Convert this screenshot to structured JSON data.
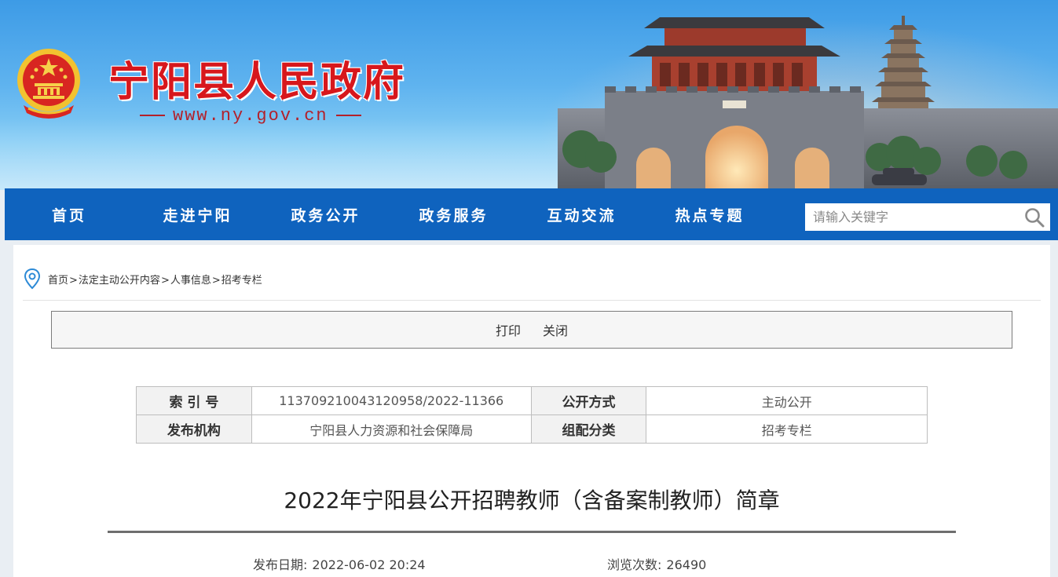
{
  "header": {
    "site_title": "宁阳县人民政府",
    "site_url": "www.ny.gov.cn"
  },
  "nav": {
    "items": [
      "首页",
      "走进宁阳",
      "政务公开",
      "政务服务",
      "互动交流",
      "热点专题"
    ],
    "search_placeholder": "请输入关键字"
  },
  "breadcrumb": {
    "items": [
      "首页",
      "法定主动公开内容",
      "人事信息",
      "招考专栏"
    ],
    "separator": ">"
  },
  "toolbar": {
    "print_label": "打印",
    "close_label": "关闭"
  },
  "meta_table": {
    "index_label": "索 引 号",
    "index_value": "11370921004312095 8/2022-11366",
    "disclosure_label": "公开方式",
    "disclosure_value": "主动公开",
    "publisher_label": "发布机构",
    "publisher_value": "宁阳县人力资源和社会保障局",
    "category_label": "组配分类",
    "category_value": "招考专栏"
  },
  "article": {
    "title": "2022年宁阳县公开招聘教师（含备案制教师）简章",
    "publish_date_label": "发布日期:",
    "publish_date": "2022-06-02 20:24",
    "views_label": "浏览次数:",
    "views": "26490"
  },
  "colors": {
    "nav_bg": "#0f63be",
    "title_red": "#d7171c",
    "url_red": "#b3202a"
  }
}
